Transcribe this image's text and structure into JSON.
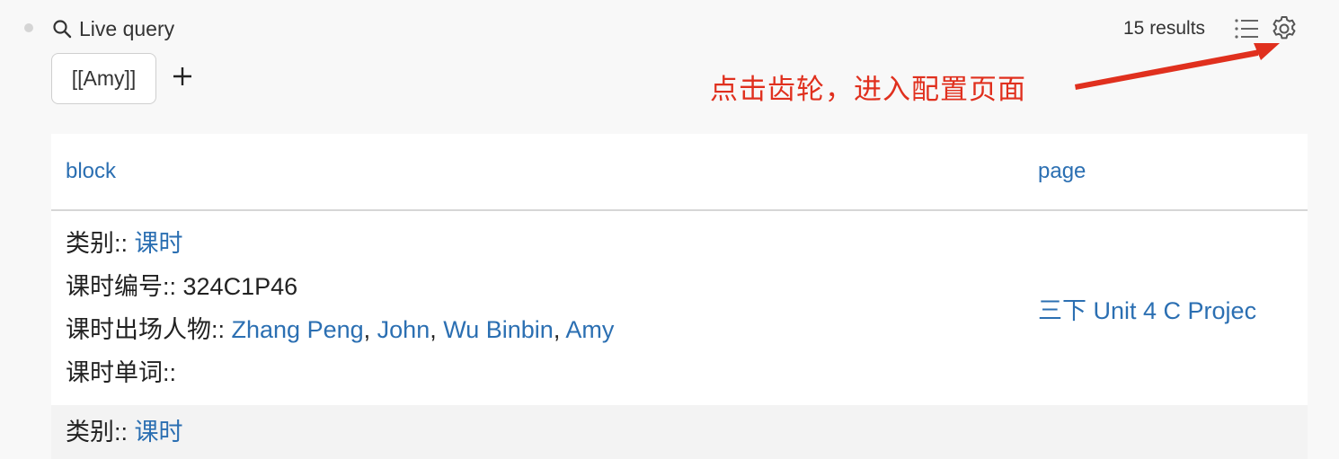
{
  "header": {
    "title": "Live query",
    "results_count": "15 results"
  },
  "filters": [
    {
      "label": "[[Amy]]"
    }
  ],
  "annotation": {
    "text": "点击齿轮，进入配置页面",
    "color": "#e0301e"
  },
  "table": {
    "columns": [
      "block",
      "page"
    ],
    "rows": [
      {
        "category_key": "类别:: ",
        "category_value": "课时",
        "lesson_no_key": "课时编号:: ",
        "lesson_no_value": "324C1P46",
        "characters_key": "课时出场人物:: ",
        "characters": [
          "Zhang Peng",
          "John",
          "Wu Binbin",
          "Amy"
        ],
        "separator": ", ",
        "words_key": "课时单词::",
        "page": "三下 Unit 4 C Projec"
      },
      {
        "category_key": "类别:: ",
        "category_value": "课时"
      }
    ]
  },
  "icons": {
    "search": "search-icon",
    "add": "plus-icon",
    "list": "list-icon",
    "settings": "gear-icon"
  },
  "colors": {
    "link": "#2b6fb2",
    "annotation": "#e0301e",
    "background": "#f8f8f8"
  }
}
